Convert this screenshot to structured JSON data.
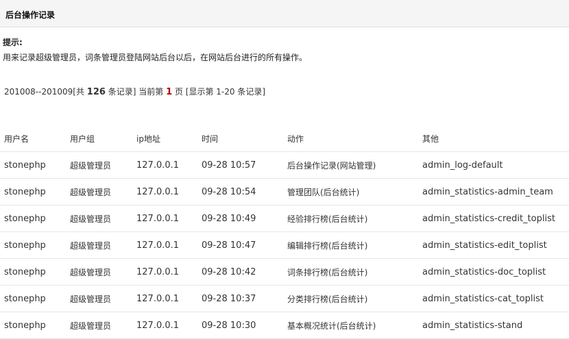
{
  "header": {
    "title": "后台操作记录"
  },
  "tip": {
    "label": "提示:",
    "text": "用来记录超级管理员，词条管理员登陆网站后台以后，在网站后台进行的所有操作。"
  },
  "summary": {
    "range": "201008--201009",
    "prefix": "[共",
    "total": "126",
    "mid1": "条记录] 当前第",
    "page": "1",
    "mid2": "页 [显示第",
    "shown": "1-20",
    "suffix": "条记录]"
  },
  "table": {
    "headers": [
      "用户名",
      "用户组",
      "ip地址",
      "时间",
      "动作",
      "其他"
    ],
    "rows": [
      [
        "stonephp",
        "超级管理员",
        "127.0.0.1",
        "09-28 10:57",
        "后台操作记录(网站管理)",
        "admin_log-default"
      ],
      [
        "stonephp",
        "超级管理员",
        "127.0.0.1",
        "09-28 10:54",
        "管理团队(后台统计)",
        "admin_statistics-admin_team"
      ],
      [
        "stonephp",
        "超级管理员",
        "127.0.0.1",
        "09-28 10:49",
        "经验排行榜(后台统计)",
        "admin_statistics-credit_toplist"
      ],
      [
        "stonephp",
        "超级管理员",
        "127.0.0.1",
        "09-28 10:47",
        "编辑排行榜(后台统计)",
        "admin_statistics-edit_toplist"
      ],
      [
        "stonephp",
        "超级管理员",
        "127.0.0.1",
        "09-28 10:42",
        "词条排行榜(后台统计)",
        "admin_statistics-doc_toplist"
      ],
      [
        "stonephp",
        "超级管理员",
        "127.0.0.1",
        "09-28 10:37",
        "分类排行榜(后台统计)",
        "admin_statistics-cat_toplist"
      ],
      [
        "stonephp",
        "超级管理员",
        "127.0.0.1",
        "09-28 10:30",
        "基本概况统计(后台统计)",
        "admin_statistics-stand"
      ]
    ]
  }
}
